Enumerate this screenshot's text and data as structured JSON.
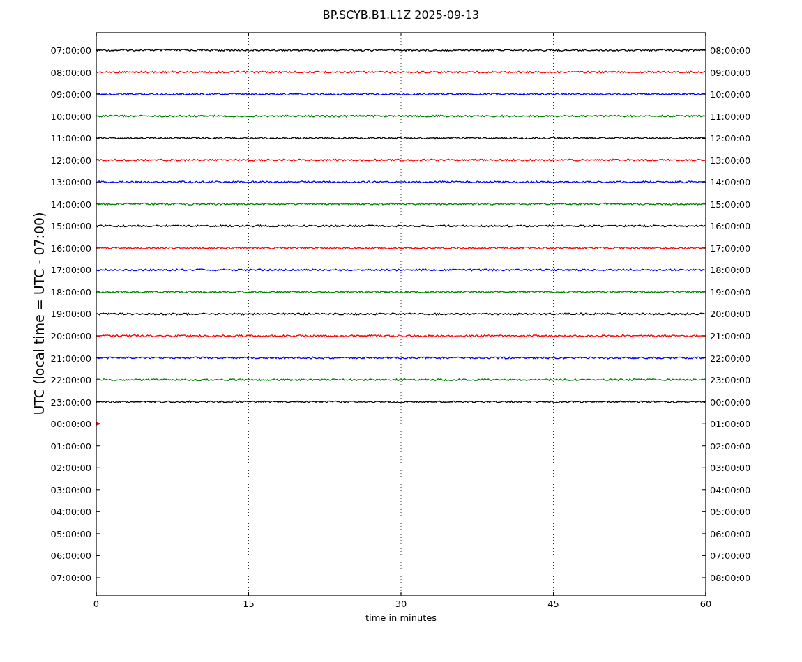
{
  "title": "BP.SCYB.B1.L1Z 2025-09-13",
  "ylabel": "UTC (local time = UTC - 07:00)",
  "xlabel": "time in minutes",
  "xticks": [
    "0",
    "15",
    "30",
    "45",
    "60"
  ],
  "left_labels": [
    "07:00:00",
    "08:00:00",
    "09:00:00",
    "10:00:00",
    "11:00:00",
    "12:00:00",
    "13:00:00",
    "14:00:00",
    "15:00:00",
    "16:00:00",
    "17:00:00",
    "18:00:00",
    "19:00:00",
    "20:00:00",
    "21:00:00",
    "22:00:00",
    "23:00:00",
    "00:00:00",
    "01:00:00",
    "02:00:00",
    "03:00:00",
    "04:00:00",
    "05:00:00",
    "06:00:00",
    "07:00:00"
  ],
  "right_labels": [
    "08:00:00",
    "09:00:00",
    "10:00:00",
    "11:00:00",
    "12:00:00",
    "13:00:00",
    "14:00:00",
    "15:00:00",
    "16:00:00",
    "17:00:00",
    "18:00:00",
    "19:00:00",
    "20:00:00",
    "21:00:00",
    "22:00:00",
    "23:00:00",
    "00:00:00",
    "01:00:00",
    "02:00:00",
    "03:00:00",
    "04:00:00",
    "05:00:00",
    "06:00:00",
    "07:00:00",
    "08:00:00"
  ],
  "traces": [
    {
      "color": "#000000",
      "kind": "full"
    },
    {
      "color": "#ff0000",
      "kind": "full"
    },
    {
      "color": "#0000ff",
      "kind": "full"
    },
    {
      "color": "#008000",
      "kind": "full"
    },
    {
      "color": "#000000",
      "kind": "full"
    },
    {
      "color": "#ff0000",
      "kind": "full"
    },
    {
      "color": "#0000ff",
      "kind": "full"
    },
    {
      "color": "#008000",
      "kind": "full"
    },
    {
      "color": "#000000",
      "kind": "full"
    },
    {
      "color": "#ff0000",
      "kind": "full"
    },
    {
      "color": "#0000ff",
      "kind": "full"
    },
    {
      "color": "#008000",
      "kind": "full"
    },
    {
      "color": "#000000",
      "kind": "full"
    },
    {
      "color": "#ff0000",
      "kind": "full"
    },
    {
      "color": "#0000ff",
      "kind": "full"
    },
    {
      "color": "#008000",
      "kind": "full"
    },
    {
      "color": "#000000",
      "kind": "full"
    },
    {
      "color": "#ff0000",
      "kind": "stub"
    }
  ]
}
